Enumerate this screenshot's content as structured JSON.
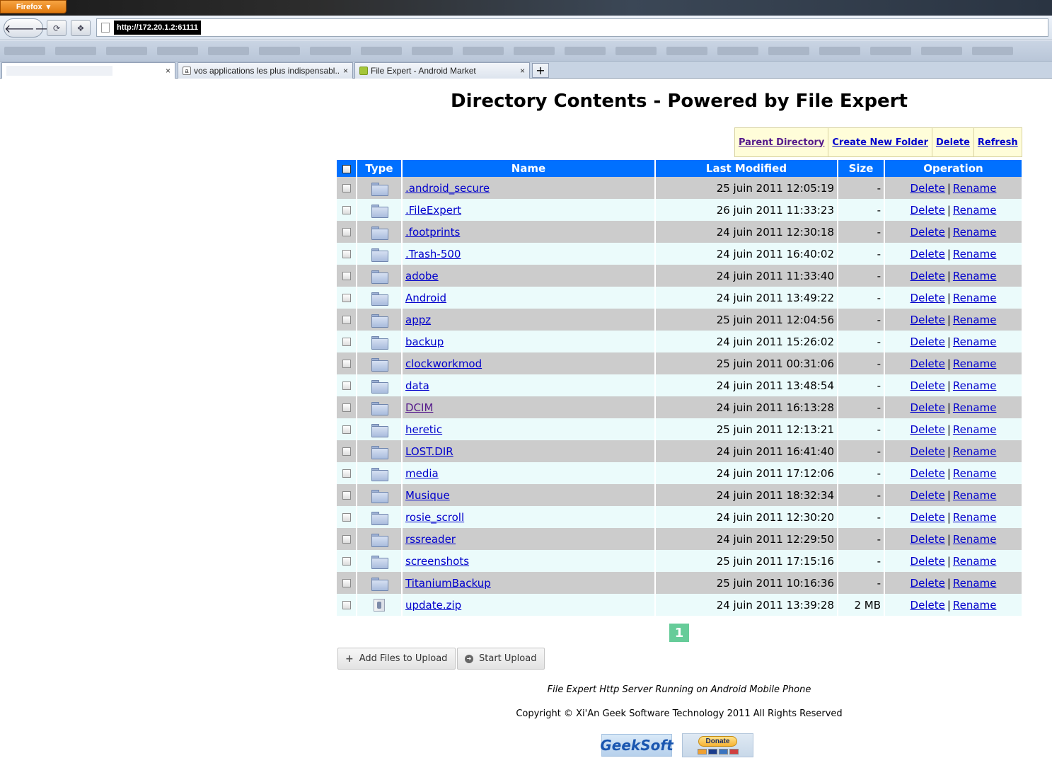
{
  "browser": {
    "menu_button": "Firefox",
    "url": "http://172.20.1.2:61111",
    "tabs": [
      {
        "title": ""
      },
      {
        "title": "vos applications les plus indispensabl..."
      },
      {
        "title": "File Expert - Android Market"
      }
    ],
    "new_tab": "+",
    "close_glyph": "×"
  },
  "page": {
    "title": "Directory Contents - Powered by File Expert",
    "toolbar": {
      "parent_directory": "Parent Directory",
      "create_new_folder": "Create New Folder",
      "delete": "Delete",
      "refresh": "Refresh"
    },
    "table": {
      "headers": {
        "type": "Type",
        "name": "Name",
        "last_modified": "Last Modified",
        "size": "Size",
        "operation": "Operation"
      },
      "op_delete": "Delete",
      "op_separator": "|",
      "op_rename": "Rename",
      "rows": [
        {
          "type": "folder",
          "name": ".android_secure",
          "modified": "25 juin 2011 12:05:19",
          "size": "-"
        },
        {
          "type": "folder",
          "name": ".FileExpert",
          "modified": "26 juin 2011 11:33:23",
          "size": "-"
        },
        {
          "type": "folder",
          "name": ".footprints",
          "modified": "24 juin 2011 12:30:18",
          "size": "-"
        },
        {
          "type": "folder",
          "name": ".Trash-500",
          "modified": "24 juin 2011 16:40:02",
          "size": "-"
        },
        {
          "type": "folder",
          "name": "adobe",
          "modified": "24 juin 2011 11:33:40",
          "size": "-"
        },
        {
          "type": "folder",
          "name": "Android",
          "modified": "24 juin 2011 13:49:22",
          "size": "-"
        },
        {
          "type": "folder",
          "name": "appz",
          "modified": "25 juin 2011 12:04:56",
          "size": "-"
        },
        {
          "type": "folder",
          "name": "backup",
          "modified": "24 juin 2011 15:26:02",
          "size": "-"
        },
        {
          "type": "folder",
          "name": "clockworkmod",
          "modified": "25 juin 2011 00:31:06",
          "size": "-"
        },
        {
          "type": "folder",
          "name": "data",
          "modified": "24 juin 2011 13:48:54",
          "size": "-"
        },
        {
          "type": "folder",
          "name": "DCIM",
          "modified": "24 juin 2011 16:13:28",
          "size": "-",
          "visited": true
        },
        {
          "type": "folder",
          "name": "heretic",
          "modified": "25 juin 2011 12:13:21",
          "size": "-"
        },
        {
          "type": "folder",
          "name": "LOST.DIR",
          "modified": "24 juin 2011 16:41:40",
          "size": "-"
        },
        {
          "type": "folder",
          "name": "media",
          "modified": "24 juin 2011 17:12:06",
          "size": "-"
        },
        {
          "type": "folder",
          "name": "Musique",
          "modified": "24 juin 2011 18:32:34",
          "size": "-"
        },
        {
          "type": "folder",
          "name": "rosie_scroll",
          "modified": "24 juin 2011 12:30:20",
          "size": "-"
        },
        {
          "type": "folder",
          "name": "rssreader",
          "modified": "24 juin 2011 12:29:50",
          "size": "-"
        },
        {
          "type": "folder",
          "name": "screenshots",
          "modified": "25 juin 2011 17:15:16",
          "size": "-"
        },
        {
          "type": "folder",
          "name": "TitaniumBackup",
          "modified": "25 juin 2011 10:16:36",
          "size": "-"
        },
        {
          "type": "file",
          "name": "update.zip",
          "modified": "24 juin 2011 13:39:28",
          "size": "2 MB"
        }
      ]
    },
    "pagination": {
      "current_page": "1"
    },
    "upload": {
      "add_files": "Add Files to Upload",
      "start_upload": "Start Upload"
    },
    "footer": {
      "server_line": "File Expert Http Server Running on Android Mobile Phone",
      "copyright": "Copyright © Xi'An Geek Software Technology 2011 All Rights Reserved",
      "geeksoft_logo": "GeekSoft",
      "donate": "Donate"
    }
  },
  "colors": {
    "header_blue": "#0070ff",
    "row_odd": "#cccccc",
    "row_even": "#ebfbfb",
    "link": "#0000cc",
    "visited_link": "#551a8b",
    "toolbar_bg": "#fffdd9",
    "pager_green": "#66cc99"
  }
}
